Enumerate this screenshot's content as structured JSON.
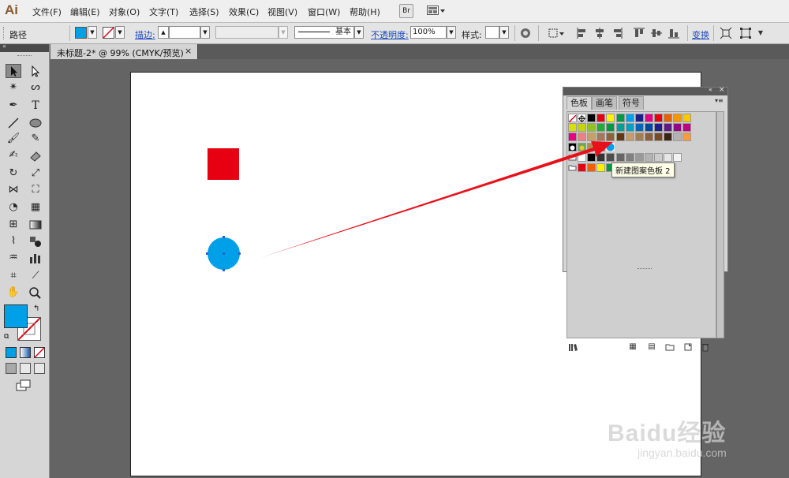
{
  "app": {
    "logo_text": "Ai"
  },
  "menubar": {
    "items": [
      "文件(F)",
      "编辑(E)",
      "对象(O)",
      "文字(T)",
      "选择(S)",
      "效果(C)",
      "视图(V)",
      "窗口(W)",
      "帮助(H)"
    ],
    "bridge_label": "Br"
  },
  "control_bar": {
    "selection_label": "路径",
    "stroke_label": "描边:",
    "stroke_style_label": "基本",
    "opacity_label": "不透明度:",
    "opacity_value": "100%",
    "style_label": "样式:",
    "transform_label": "变换"
  },
  "document": {
    "tab_title": "未标题-2* @ 99% (CMYK/预览)",
    "close_glyph": "×"
  },
  "colors": {
    "fill": "#00a0e9",
    "shape_red": "#e60012",
    "shape_blue": "#00a0e9",
    "arrow": "#e8101a"
  },
  "swatches_panel": {
    "tabs": [
      "色板",
      "画笔",
      "符号"
    ],
    "tooltip": "新建图案色板 2",
    "row1": [
      "none",
      "#ffffff",
      "#000000",
      "#e60012",
      "#fff100",
      "#009944",
      "#00a0e9",
      "#1d2088",
      "#e4007f",
      "#e60012",
      "#eb6100",
      "#f39800",
      "#fcc800"
    ],
    "row2": [
      "#d7e000",
      "#c3d600",
      "#8fc31f",
      "#22ac38",
      "#009944",
      "#009e96",
      "#00a0c1",
      "#0068b7",
      "#00479d",
      "#1d2088",
      "#601986",
      "#920783",
      "#be0081"
    ],
    "row3": [
      "#e4007f",
      "#f08080",
      "#c9a063",
      "#a7765c",
      "#8c6239",
      "#603813",
      "#c69c6d",
      "#a67c52",
      "#8b5e3c",
      "#754c24",
      "#3c2415",
      "#b3b3b3",
      "#ff9a3c"
    ],
    "row5": [
      "#ffffff",
      "#000000",
      "#333333",
      "#4d4d4d",
      "#666666",
      "#808080",
      "#999999",
      "#b3b3b3",
      "#cccccc",
      "#e6e6e6",
      "#f2f2f2"
    ],
    "row6": [
      "#e60012",
      "#eb6100",
      "#fff100",
      "#009944"
    ]
  },
  "watermark": {
    "logo_text": "Baidu经验",
    "url_text": "jingyan.baidu.com"
  }
}
